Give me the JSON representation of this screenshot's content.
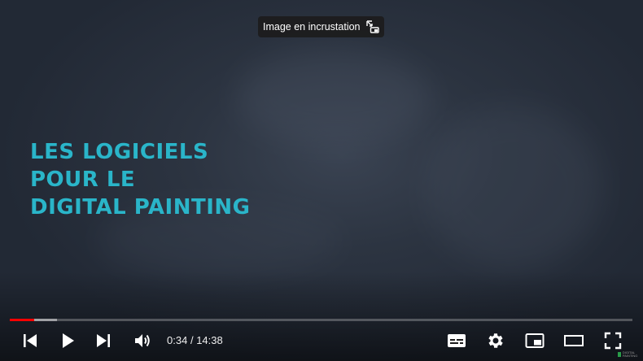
{
  "video": {
    "title_lines": [
      "LES LOGICIELS",
      "POUR LE",
      "DIGITAL PAINTING"
    ],
    "title_color": "#2ab5c9"
  },
  "tooltip": {
    "label": "Image en incrustation",
    "icon": "picture-in-picture-exit-icon"
  },
  "progress": {
    "played_fraction": 0.039,
    "loaded_fraction": 0.076,
    "played_color": "#ff0000"
  },
  "controls": {
    "current_time": "0:34",
    "separator": "/",
    "duration": "14:38",
    "time_display": "0:34 / 14:38",
    "left_icons": [
      "previous-icon",
      "play-icon",
      "next-icon",
      "volume-icon"
    ],
    "right_icons": [
      "subtitles-icon",
      "settings-gear-icon",
      "miniplayer-icon",
      "theater-mode-icon",
      "fullscreen-icon"
    ]
  },
  "watermark": {
    "text": "DIGITAL PAINTING"
  }
}
